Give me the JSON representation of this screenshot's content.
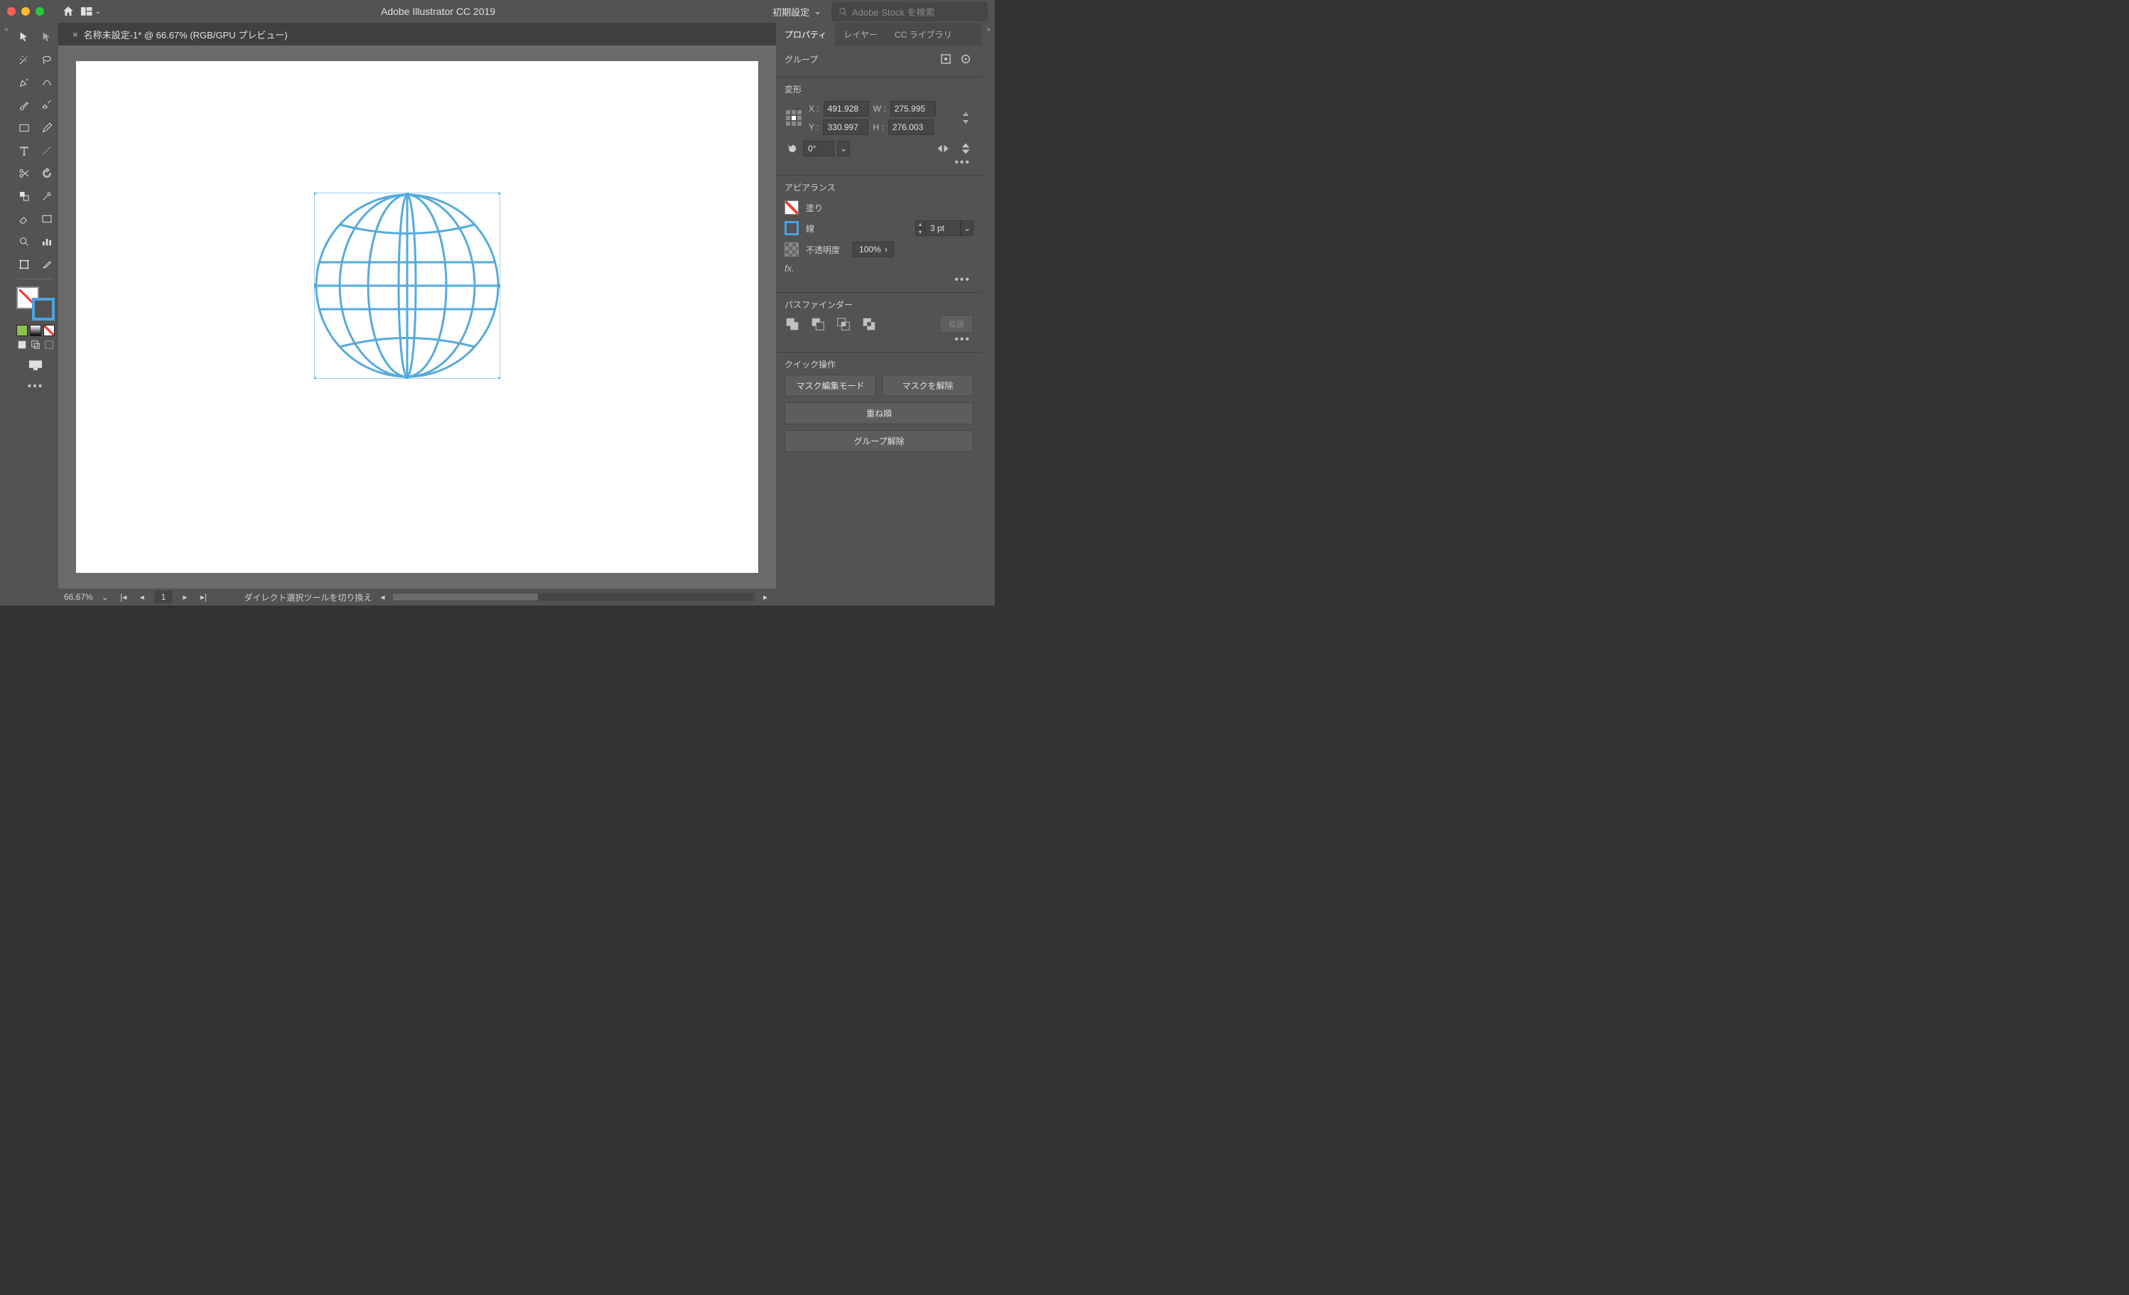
{
  "window": {
    "title": "Adobe Illustrator CC 2019",
    "workspace": "初期設定",
    "search_placeholder": "Adobe Stock を検索"
  },
  "document": {
    "tab_title": "名称未設定-1* @ 66.67% (RGB/GPU プレビュー)",
    "zoom": "66.67%",
    "page": "1",
    "hint": "ダイレクト選択ツールを切り換え"
  },
  "panels": {
    "tabs": {
      "properties": "プロパティ",
      "layers": "レイヤー",
      "cc_libraries": "CC ライブラリ"
    },
    "selection_type": "グループ",
    "transform": {
      "title": "変形",
      "x_label": "X :",
      "x": "491.928",
      "y_label": "Y :",
      "y": "330.997",
      "w_label": "W :",
      "w": "275.995",
      "h_label": "H :",
      "h": "276.003",
      "rotate": "0°"
    },
    "appearance": {
      "title": "アピアランス",
      "fill_label": "塗り",
      "stroke_label": "線",
      "stroke_weight": "3 pt",
      "opacity_label": "不透明度",
      "opacity": "100%",
      "fx": "fx."
    },
    "pathfinder": {
      "title": "パスファインダー",
      "expand": "拡張"
    },
    "quick": {
      "title": "クイック操作",
      "mask_edit": "マスク編集モード",
      "mask_release": "マスクを解除",
      "arrange": "重ね順",
      "ungroup": "グループ解除"
    }
  }
}
